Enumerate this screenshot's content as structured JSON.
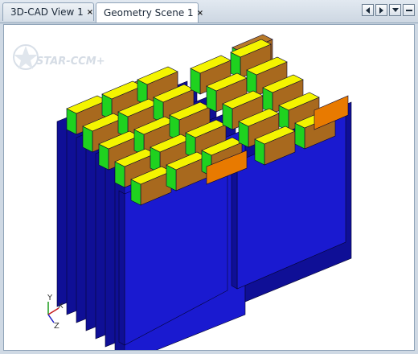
{
  "tabs": [
    {
      "label": "3D-CAD View 1",
      "close": "×"
    },
    {
      "label": "Geometry Scene 1",
      "close": "×"
    }
  ],
  "watermark": {
    "text": "STAR-CCM+"
  },
  "axes": {
    "y": "Y",
    "x": "X",
    "z": "Z"
  },
  "colors": {
    "cell_body": "#1a1ad0",
    "cell_side": "#0f0f96",
    "terminal_cap": "#f4f400",
    "terminal_band": "#1fd21f",
    "terminal_block": "#a8691e",
    "orange_terminal": "#e87a00"
  },
  "icons": [
    "arrow-left-icon",
    "arrow-right-icon",
    "dropdown-icon",
    "minimize-icon"
  ]
}
